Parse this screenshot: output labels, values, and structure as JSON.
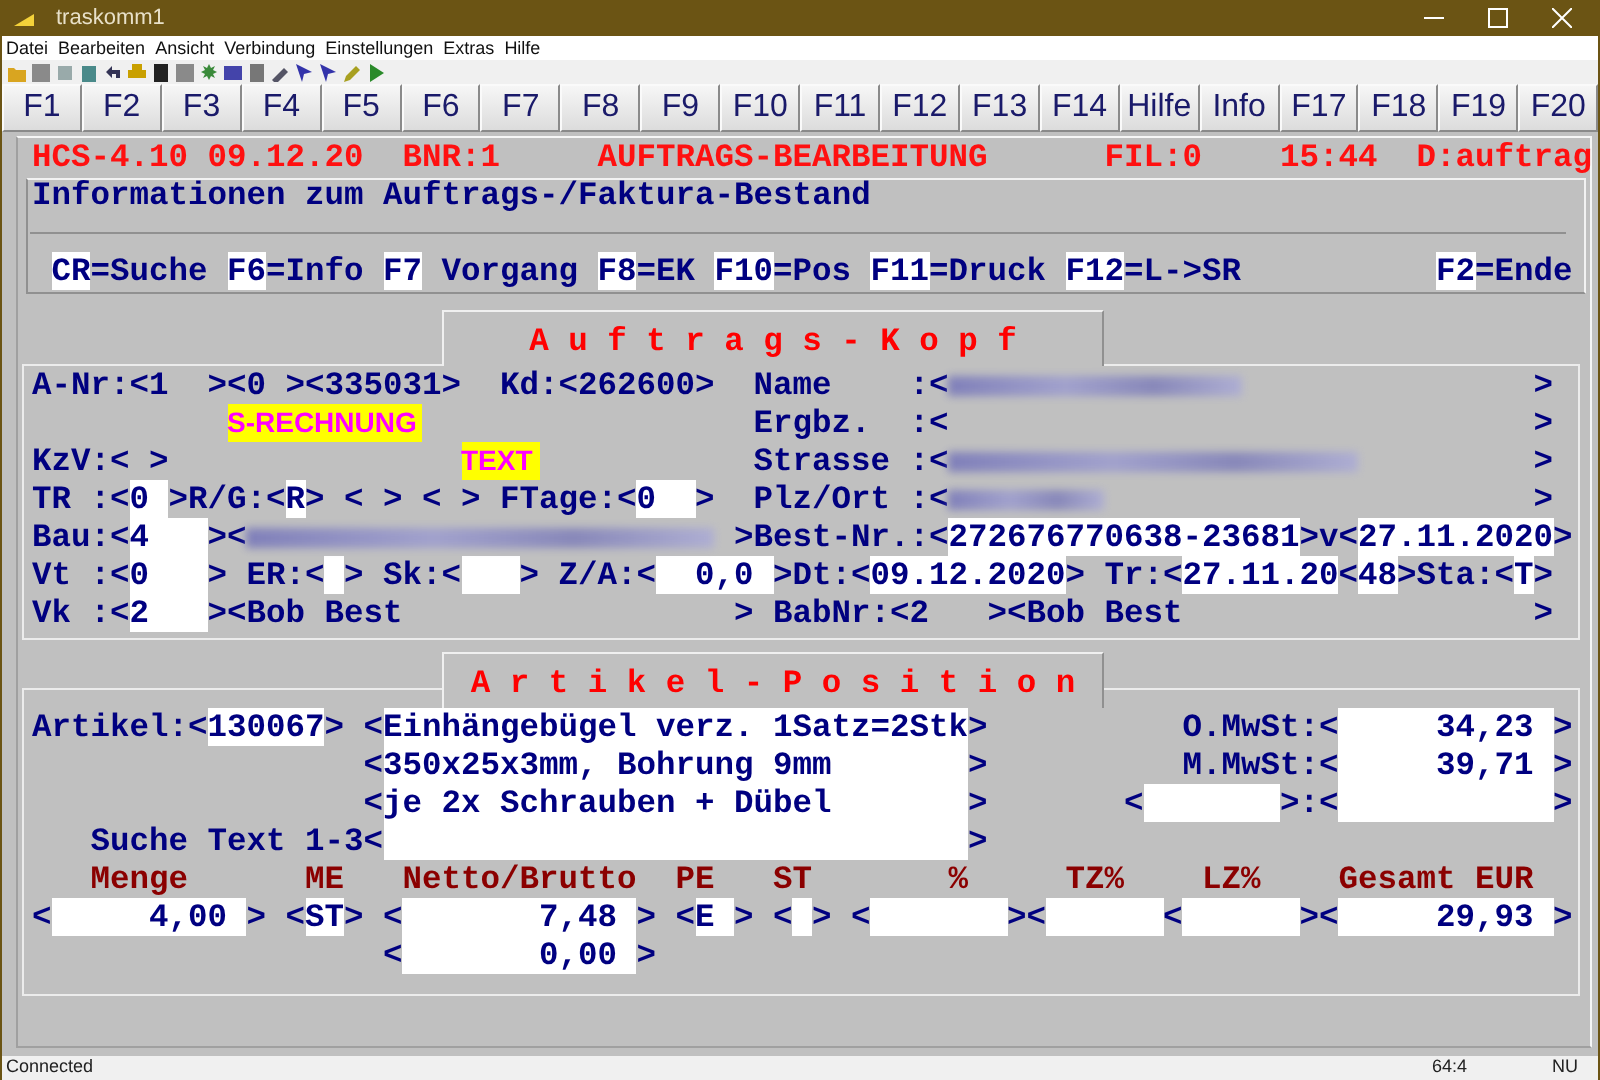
{
  "window": {
    "title": "traskomm1"
  },
  "menu": [
    "Datei",
    "Bearbeiten",
    "Ansicht",
    "Verbindung",
    "Einstellungen",
    "Extras",
    "Hilfe"
  ],
  "function_keys": [
    "F1",
    "F2",
    "F3",
    "F4",
    "F5",
    "F6",
    "F7",
    "F8",
    "F9",
    "F10",
    "F11",
    "F12",
    "F13",
    "F14",
    "Hilfe",
    "Info",
    "F17",
    "F18",
    "F19",
    "F20"
  ],
  "terminal_rows": [
    {
      "segments": [
        {
          "kind": "title",
          "text": "HCS-4.10"
        },
        {
          "kind": "title",
          "text": "09.12.20"
        },
        {
          "kind": "title",
          "text": "BNR:1"
        },
        {
          "kind": "title",
          "text": "AUFTRAGS-BEARBEITUNG"
        },
        {
          "kind": "title",
          "text": "FIL:0"
        },
        {
          "kind": "title",
          "text": "15:44"
        },
        {
          "kind": "title",
          "text": "D:auftrag"
        }
      ]
    },
    {
      "segments": [
        {
          "kind": "label",
          "text": "Informationen zum Auftrags-/Faktura-Bestand"
        }
      ]
    },
    {
      "segments": [
        {
          "kind": "key",
          "text": "CR"
        },
        {
          "kind": "label",
          "text": "=Suche"
        },
        {
          "kind": "key",
          "text": "F6"
        },
        {
          "kind": "label",
          "text": "=Info"
        },
        {
          "kind": "key",
          "text": "F7"
        },
        {
          "kind": "label",
          "text": "Vorgang"
        },
        {
          "kind": "key",
          "text": "F8"
        },
        {
          "kind": "label",
          "text": "=EK"
        },
        {
          "kind": "key",
          "text": "F10"
        },
        {
          "kind": "label",
          "text": "=Pos"
        },
        {
          "kind": "key",
          "text": "F11"
        },
        {
          "kind": "label",
          "text": "=Druck"
        },
        {
          "kind": "key",
          "text": "F12"
        },
        {
          "kind": "label",
          "text": "=L->SR"
        },
        {
          "kind": "key",
          "text": "F2"
        },
        {
          "kind": "label",
          "text": "=Ende"
        }
      ]
    },
    {
      "segments": [
        {
          "kind": "heading",
          "text": "A u f t r a g s - K o p f"
        }
      ]
    },
    {
      "segments": [
        {
          "kind": "label",
          "text": "A-Nr:<1"
        },
        {
          "kind": "label",
          "text": "><0 ><335031>"
        },
        {
          "kind": "label",
          "text": "Kd:<262600>"
        },
        {
          "kind": "label",
          "text": "Name"
        },
        {
          "kind": "label",
          "text": ":<"
        },
        {
          "kind": "redacted"
        },
        {
          "kind": "label",
          "text": ">"
        }
      ]
    },
    {
      "segments": [
        {
          "kind": "mark",
          "text": "S-RECHNUNG"
        },
        {
          "kind": "label",
          "text": "Ergbz."
        },
        {
          "kind": "label",
          "text": ":<"
        },
        {
          "kind": "label",
          "text": ">"
        }
      ]
    },
    {
      "segments": [
        {
          "kind": "label",
          "text": "KzV:< >"
        },
        {
          "kind": "mark",
          "text": "TEXT"
        },
        {
          "kind": "label",
          "text": "Strasse"
        },
        {
          "kind": "label",
          "text": ":<"
        },
        {
          "kind": "redacted"
        },
        {
          "kind": "label",
          "text": ">"
        }
      ]
    },
    {
      "segments": [
        {
          "kind": "label",
          "text": "TR :<"
        },
        {
          "kind": "field",
          "text": "0"
        },
        {
          "kind": "label",
          "text": ">R/G:<"
        },
        {
          "kind": "field",
          "text": "R"
        },
        {
          "kind": "label",
          "text": "> < > < >"
        },
        {
          "kind": "label",
          "text": "FTage:<"
        },
        {
          "kind": "field",
          "text": "0"
        },
        {
          "kind": "label",
          "text": ">"
        },
        {
          "kind": "label",
          "text": "Plz/Ort"
        },
        {
          "kind": "label",
          "text": ":<"
        },
        {
          "kind": "redacted"
        },
        {
          "kind": "label",
          "text": ">"
        }
      ]
    },
    {
      "segments": [
        {
          "kind": "label",
          "text": "Bau:<"
        },
        {
          "kind": "field",
          "text": "4"
        },
        {
          "kind": "label",
          "text": "><"
        },
        {
          "kind": "redacted"
        },
        {
          "kind": "label",
          "text": ">Best-Nr.:<"
        },
        {
          "kind": "field",
          "text": "272676770638-23681"
        },
        {
          "kind": "label",
          "text": ">v<"
        },
        {
          "kind": "field",
          "text": "27.11.2020"
        },
        {
          "kind": "label",
          "text": ">"
        }
      ]
    },
    {
      "segments": [
        {
          "kind": "label",
          "text": "Vt :<"
        },
        {
          "kind": "field",
          "text": "0"
        },
        {
          "kind": "label",
          "text": "> ER:<"
        },
        {
          "kind": "field"
        },
        {
          "kind": "label",
          "text": "> Sk:<"
        },
        {
          "kind": "field"
        },
        {
          "kind": "label",
          "text": "> Z/A:<"
        },
        {
          "kind": "num",
          "text": "0,0"
        },
        {
          "kind": "label",
          "text": ">Dt:<"
        },
        {
          "kind": "field",
          "text": "09.12.2020"
        },
        {
          "kind": "label",
          "text": "> Tr:<"
        },
        {
          "kind": "field",
          "text": "27.11.20"
        },
        {
          "kind": "label",
          "text": "<"
        },
        {
          "kind": "field",
          "text": "48"
        },
        {
          "kind": "label",
          "text": ">Sta:<"
        },
        {
          "kind": "field",
          "text": "T"
        },
        {
          "kind": "label",
          "text": ">"
        }
      ]
    },
    {
      "segments": [
        {
          "kind": "label",
          "text": "Vk :<"
        },
        {
          "kind": "field",
          "text": "2"
        },
        {
          "kind": "label",
          "text": "><Bob Best"
        },
        {
          "kind": "label",
          "text": "> BabNr:<2"
        },
        {
          "kind": "label",
          "text": "><Bob Best"
        },
        {
          "kind": "label",
          "text": ">"
        }
      ]
    },
    {
      "segments": [
        {
          "kind": "heading",
          "text": "A r t i k e l - P o s i t i o n"
        }
      ]
    },
    {
      "segments": [
        {
          "kind": "label",
          "text": "Artikel:<"
        },
        {
          "kind": "field",
          "text": "130067"
        },
        {
          "kind": "label",
          "text": "> <"
        },
        {
          "kind": "field",
          "text": "Einhängebügel verz. 1Satz=2Stk"
        },
        {
          "kind": "label",
          "text": ">"
        },
        {
          "kind": "label",
          "text": "O.MwSt:<"
        },
        {
          "kind": "num",
          "text": "34,23"
        },
        {
          "kind": "label",
          "text": ">"
        }
      ]
    },
    {
      "segments": [
        {
          "kind": "label",
          "text": "<"
        },
        {
          "kind": "field",
          "text": "350x25x3mm, Bohrung 9mm"
        },
        {
          "kind": "label",
          "text": ">"
        },
        {
          "kind": "label",
          "text": "M.MwSt:<"
        },
        {
          "kind": "num",
          "text": "39,71"
        },
        {
          "kind": "label",
          "text": ">"
        }
      ]
    },
    {
      "segments": [
        {
          "kind": "label",
          "text": "<"
        },
        {
          "kind": "field",
          "text": "je 2x Schrauben + Dübel"
        },
        {
          "kind": "label",
          "text": ">"
        },
        {
          "kind": "label",
          "text": "<"
        },
        {
          "kind": "field"
        },
        {
          "kind": "label",
          "text": ">:<"
        },
        {
          "kind": "field"
        },
        {
          "kind": "label",
          "text": ">"
        }
      ]
    },
    {
      "segments": [
        {
          "kind": "label",
          "text": "Suche Text 1-3"
        },
        {
          "kind": "label",
          "text": "<"
        },
        {
          "kind": "field"
        },
        {
          "kind": "label",
          "text": ">"
        }
      ]
    },
    {
      "segments": [
        {
          "kind": "column",
          "text": "Menge"
        },
        {
          "kind": "column",
          "text": "ME"
        },
        {
          "kind": "column",
          "text": "Netto/Brutto"
        },
        {
          "kind": "column",
          "text": "PE"
        },
        {
          "kind": "column",
          "text": "ST"
        },
        {
          "kind": "column",
          "text": "%"
        },
        {
          "kind": "column",
          "text": "TZ%"
        },
        {
          "kind": "column",
          "text": "LZ%"
        },
        {
          "kind": "column",
          "text": "Gesamt EUR"
        }
      ]
    },
    {
      "segments": [
        {
          "kind": "label",
          "text": "<"
        },
        {
          "kind": "num",
          "text": "4,00"
        },
        {
          "kind": "label",
          "text": ">"
        },
        {
          "kind": "label",
          "text": "<"
        },
        {
          "kind": "field",
          "text": "ST"
        },
        {
          "kind": "label",
          "text": ">"
        },
        {
          "kind": "label",
          "text": "<"
        },
        {
          "kind": "num",
          "text": "7,48"
        },
        {
          "kind": "label",
          "text": ">"
        },
        {
          "kind": "label",
          "text": "<"
        },
        {
          "kind": "field",
          "text": "E"
        },
        {
          "kind": "label",
          "text": ">"
        },
        {
          "kind": "label",
          "text": "<"
        },
        {
          "kind": "field"
        },
        {
          "kind": "label",
          "text": ">"
        },
        {
          "kind": "label",
          "text": "<"
        },
        {
          "kind": "field"
        },
        {
          "kind": "label",
          "text": "><"
        },
        {
          "kind": "field"
        },
        {
          "kind": "label",
          "text": "<"
        },
        {
          "kind": "field"
        },
        {
          "kind": "label",
          "text": "><"
        },
        {
          "kind": "num",
          "text": "29,93"
        },
        {
          "kind": "label",
          "text": ">"
        }
      ]
    },
    {
      "segments": [
        {
          "kind": "label",
          "text": "<"
        },
        {
          "kind": "num",
          "text": "0,00"
        },
        {
          "kind": "label",
          "text": ">"
        }
      ]
    }
  ],
  "status_bar": [
    "Connected",
    "64:4",
    "NU"
  ]
}
